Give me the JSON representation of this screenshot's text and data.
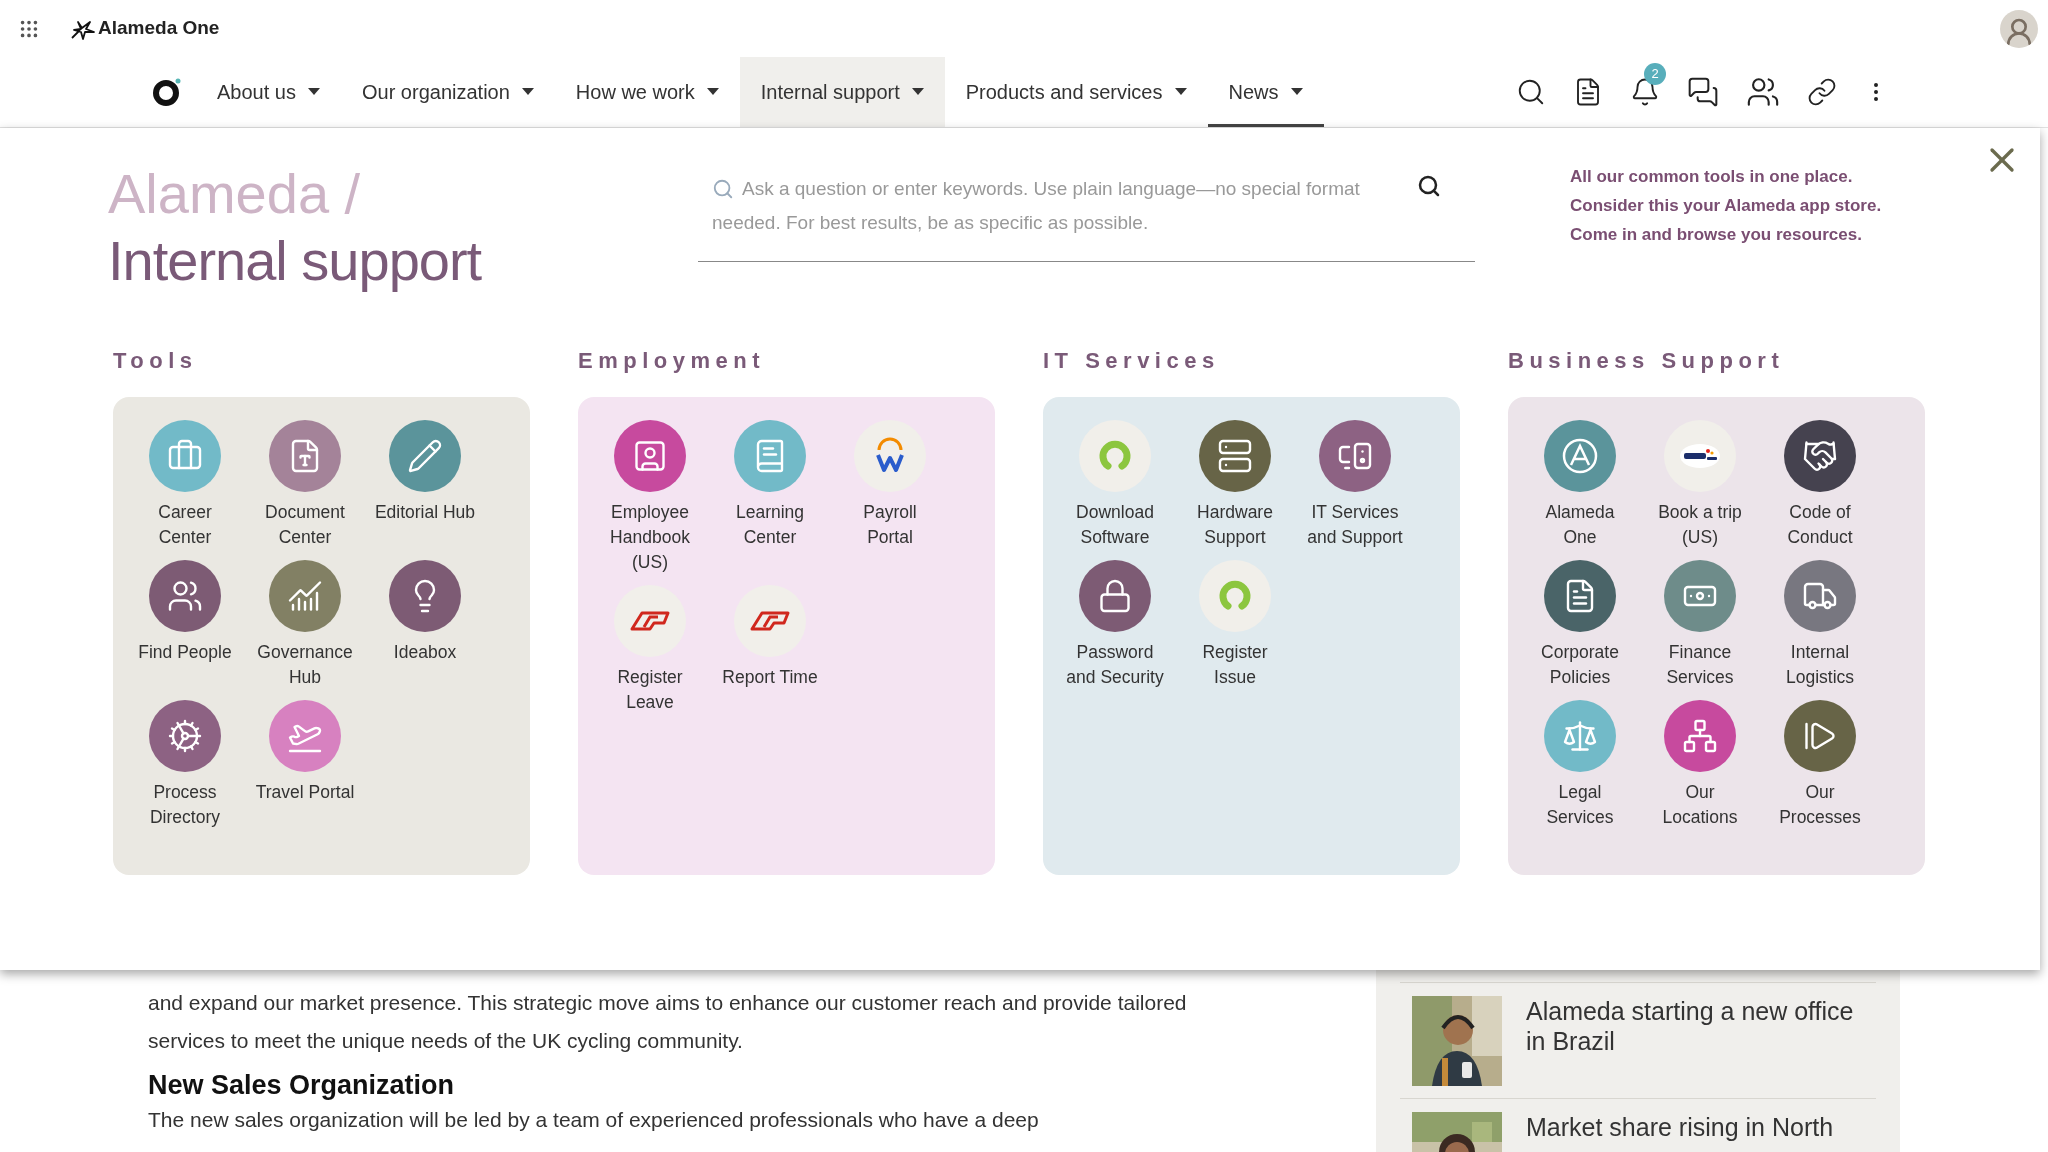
{
  "top_bar": {
    "app_name": "Alameda One"
  },
  "nav": {
    "items": [
      {
        "label": "About us",
        "selected": false,
        "current": false
      },
      {
        "label": "Our organization",
        "selected": false,
        "current": false
      },
      {
        "label": "How we work",
        "selected": false,
        "current": false
      },
      {
        "label": "Internal support",
        "selected": true,
        "current": false
      },
      {
        "label": "Products and services",
        "selected": false,
        "current": false
      },
      {
        "label": "News",
        "selected": false,
        "current": true
      }
    ],
    "notification_count": "2"
  },
  "mega_menu": {
    "breadcrumb": "Alameda /",
    "title": "Internal support",
    "search": {
      "placeholder": "Ask a question or enter keywords. Use plain language—no special format needed. For best results, be as specific as possible."
    },
    "intro": [
      "All our common tools in one place.",
      "Consider this your Alameda app store.",
      "Come in and browse you resources."
    ],
    "sections": [
      {
        "title": "Tools",
        "items": [
          {
            "label": "Career Center"
          },
          {
            "label": "Document Center"
          },
          {
            "label": "Editorial Hub"
          },
          {
            "label": "Find People"
          },
          {
            "label": "Governance Hub"
          },
          {
            "label": "Ideabox"
          },
          {
            "label": "Process Directory"
          },
          {
            "label": "Travel Portal"
          }
        ]
      },
      {
        "title": "Employment",
        "items": [
          {
            "label": "Employee Handbook (US)"
          },
          {
            "label": "Learning Center"
          },
          {
            "label": "Payroll Portal"
          },
          {
            "label": "Register Leave"
          },
          {
            "label": "Report Time"
          }
        ]
      },
      {
        "title": "IT Services",
        "items": [
          {
            "label": "Download Software"
          },
          {
            "label": "Hardware Support"
          },
          {
            "label": "IT Services and Support"
          },
          {
            "label": "Password and Security"
          },
          {
            "label": "Register Issue"
          }
        ]
      },
      {
        "title": "Business Support",
        "items": [
          {
            "label": "Alameda One"
          },
          {
            "label": "Book a trip (US)"
          },
          {
            "label": "Code of Conduct"
          },
          {
            "label": "Corporate Policies"
          },
          {
            "label": "Finance Services"
          },
          {
            "label": "Internal Logistics"
          },
          {
            "label": "Legal Services"
          },
          {
            "label": "Our Locations"
          },
          {
            "label": "Our Processes"
          }
        ]
      }
    ]
  },
  "article": {
    "paragraph": "and expand our market presence. This strategic move aims to enhance our customer reach and provide tailored services to meet the unique needs of the UK cycling community.",
    "heading": "New Sales Organization",
    "paragraph_2": "The new sales organization will be led by a team of experienced professionals who have a deep"
  },
  "news": [
    {
      "title": "Alameda starting a new office in Brazil"
    },
    {
      "title": "Market share rising in North"
    }
  ]
}
